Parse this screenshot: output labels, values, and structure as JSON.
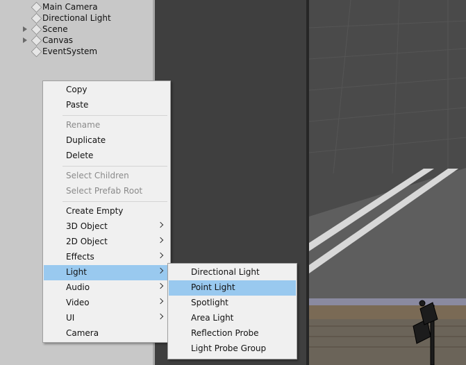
{
  "hierarchy": {
    "items": [
      {
        "label": "Main Camera",
        "expandable": false
      },
      {
        "label": "Directional Light",
        "expandable": false
      },
      {
        "label": "Scene",
        "expandable": true
      },
      {
        "label": "Canvas",
        "expandable": true
      },
      {
        "label": "EventSystem",
        "expandable": false
      }
    ]
  },
  "context_menu": {
    "items": [
      {
        "label": "Copy"
      },
      {
        "label": "Paste"
      },
      {
        "label": "Rename",
        "disabled": true
      },
      {
        "label": "Duplicate"
      },
      {
        "label": "Delete"
      },
      {
        "label": "Select Children",
        "disabled": true
      },
      {
        "label": "Select Prefab Root",
        "disabled": true
      },
      {
        "label": "Create Empty"
      },
      {
        "label": "3D Object",
        "submenu": true
      },
      {
        "label": "2D Object",
        "submenu": true
      },
      {
        "label": "Effects",
        "submenu": true
      },
      {
        "label": "Light",
        "submenu": true,
        "highlighted": true
      },
      {
        "label": "Audio",
        "submenu": true
      },
      {
        "label": "Video",
        "submenu": true
      },
      {
        "label": "UI",
        "submenu": true
      },
      {
        "label": "Camera"
      }
    ]
  },
  "light_submenu": {
    "items": [
      {
        "label": "Directional Light"
      },
      {
        "label": "Point Light",
        "highlighted": true
      },
      {
        "label": "Spotlight"
      },
      {
        "label": "Area Light"
      },
      {
        "label": "Reflection Probe"
      },
      {
        "label": "Light Probe Group"
      }
    ]
  },
  "colors": {
    "highlight": "#99c9ef",
    "menu_bg": "#f0f0f0",
    "hierarchy_bg": "#c8c8c8"
  }
}
